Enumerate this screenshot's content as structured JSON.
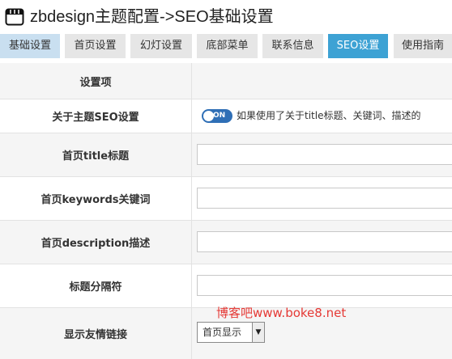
{
  "header": {
    "title": "zbdesign主题配置->SEO基础设置",
    "icon": "window-icon"
  },
  "tabs": [
    {
      "label": "基础设置",
      "active": false
    },
    {
      "label": "首页设置",
      "active": false
    },
    {
      "label": "幻灯设置",
      "active": false
    },
    {
      "label": "底部菜单",
      "active": false
    },
    {
      "label": "联系信息",
      "active": false
    },
    {
      "label": "SEO设置",
      "active": true
    },
    {
      "label": "使用指南",
      "active": false
    }
  ],
  "table": {
    "header_label": "设置项",
    "rows": [
      {
        "label": "关于主题SEO设置",
        "toggle_label": "ON",
        "toggle_on": true,
        "description": "如果使用了关于title标题、关键词、描述的"
      },
      {
        "label": "首页title标题",
        "value": ""
      },
      {
        "label": "首页keywords关键词",
        "value": ""
      },
      {
        "label": "首页description描述",
        "value": ""
      },
      {
        "label": "标题分隔符",
        "value": ""
      },
      {
        "label": "显示友情链接",
        "select_value": "首页显示"
      }
    ]
  },
  "watermark": "博客吧www.boke8.net",
  "colors": {
    "active_tab": "#3da2d4",
    "first_tab": "#c9dff0",
    "toggle": "#2f6fb6",
    "watermark": "#e53935"
  }
}
